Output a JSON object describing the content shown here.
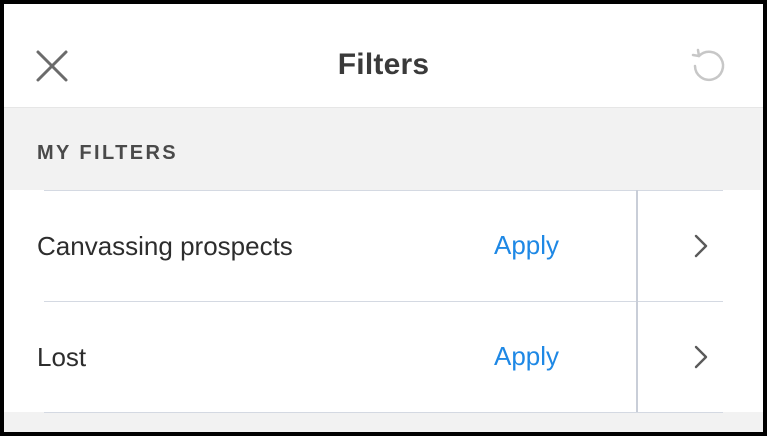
{
  "header": {
    "title": "Filters",
    "close_icon": "close-icon",
    "reset_icon": "reset-icon"
  },
  "section": {
    "title": "MY FILTERS"
  },
  "filters": [
    {
      "name": "Canvassing prospects",
      "action_label": "Apply"
    },
    {
      "name": "Lost",
      "action_label": "Apply"
    }
  ],
  "colors": {
    "accent": "#1e88e5",
    "section_bg": "#f2f2f2",
    "text": "#2d2d2d"
  }
}
